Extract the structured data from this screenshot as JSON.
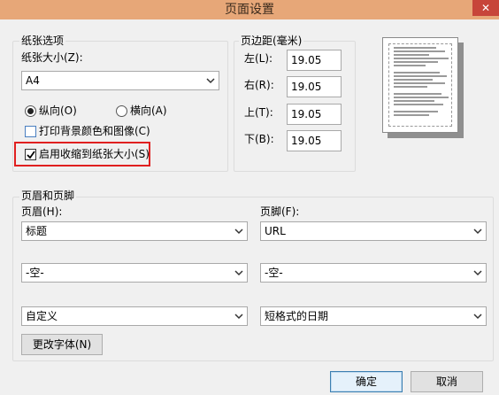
{
  "window": {
    "title": "页面设置",
    "close_glyph": "✕"
  },
  "paper": {
    "group_label": "纸张选项",
    "size_label": "纸张大小(Z):",
    "size_value": "A4",
    "orientation": {
      "portrait_label": "纵向(O)",
      "landscape_label": "横向(A)",
      "selected": "portrait"
    },
    "print_background_label": "打印背景颜色和图像(C)",
    "print_background_checked": false,
    "shrink_to_fit_label": "启用收缩到纸张大小(S)",
    "shrink_to_fit_checked": true
  },
  "margins": {
    "group_label": "页边距(毫米)",
    "left_label": "左(L):",
    "left_value": "19.05",
    "right_label": "右(R):",
    "right_value": "19.05",
    "top_label": "上(T):",
    "top_value": "19.05",
    "bottom_label": "下(B):",
    "bottom_value": "19.05"
  },
  "header_footer": {
    "group_label": "页眉和页脚",
    "header_label": "页眉(H):",
    "footer_label": "页脚(F):",
    "header_values": [
      "标题",
      "-空-",
      "自定义"
    ],
    "footer_values": [
      "URL",
      "-空-",
      "短格式的日期"
    ],
    "change_font_label": "更改字体(N)"
  },
  "buttons": {
    "ok_label": "确定",
    "cancel_label": "取消"
  },
  "colors": {
    "titlebar": "#e7a778",
    "close": "#c7453a",
    "highlight": "#e02020",
    "dialog_bg": "#f0f0f0"
  }
}
